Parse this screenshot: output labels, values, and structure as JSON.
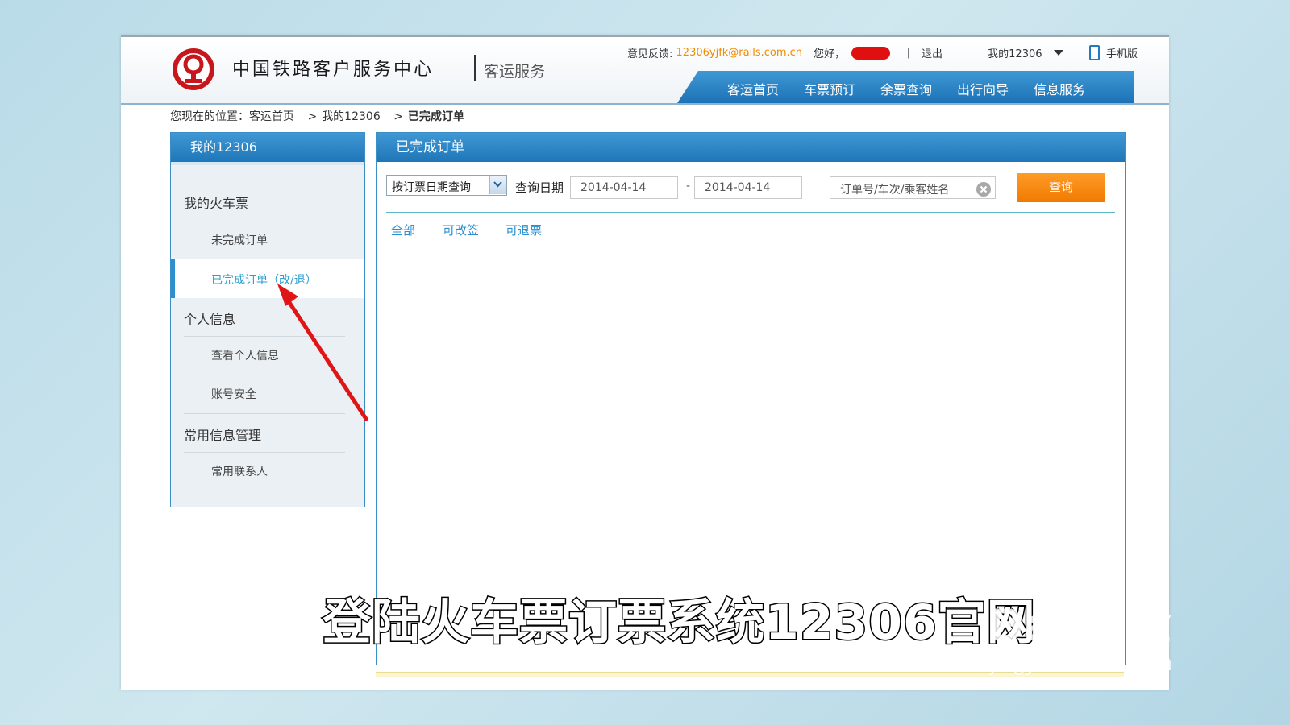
{
  "header": {
    "site_title": "中国铁路客户服务中心",
    "sub_title": "客运服务",
    "feedback_label": "意见反馈:",
    "feedback_email": "12306yjfk@rails.com.cn",
    "greeting": "您好，",
    "logout": "退出",
    "my_account": "我的12306",
    "mobile": "手机版",
    "nav": [
      "客运首页",
      "车票预订",
      "余票查询",
      "出行向导",
      "信息服务"
    ],
    "colors": {
      "brand_red": "#c8161d",
      "nav_blue": "#1f76b8",
      "accent_orange": "#f08a00"
    }
  },
  "breadcrumb": {
    "prefix": "您现在的位置：",
    "items": [
      "客运首页",
      "我的12306",
      "已完成订单"
    ]
  },
  "sidebar": {
    "title": "我的12306",
    "groups": [
      {
        "label": "我的火车票",
        "items": [
          "未完成订单",
          "已完成订单（改/退）"
        ]
      },
      {
        "label": "个人信息",
        "items": [
          "查看个人信息",
          "账号安全"
        ]
      },
      {
        "label": "常用信息管理",
        "items": [
          "常用联系人"
        ]
      }
    ],
    "active_item": "已完成订单（改/退）"
  },
  "main": {
    "title": "已完成订单",
    "query_type": "按订票日期查询",
    "date_label": "查询日期",
    "date_from": "2014-04-14",
    "date_to": "2014-04-14",
    "date_separator": "-",
    "search_placeholder": "订单号/车次/乘客姓名",
    "query_button": "查询",
    "filters": [
      "全部",
      "可改签",
      "可退票"
    ]
  },
  "overlay": {
    "caption": "登陆火车票订票系统12306官网",
    "watermark_main": "Bai 经验",
    "watermark_url": "jingyan.baidu.com"
  }
}
